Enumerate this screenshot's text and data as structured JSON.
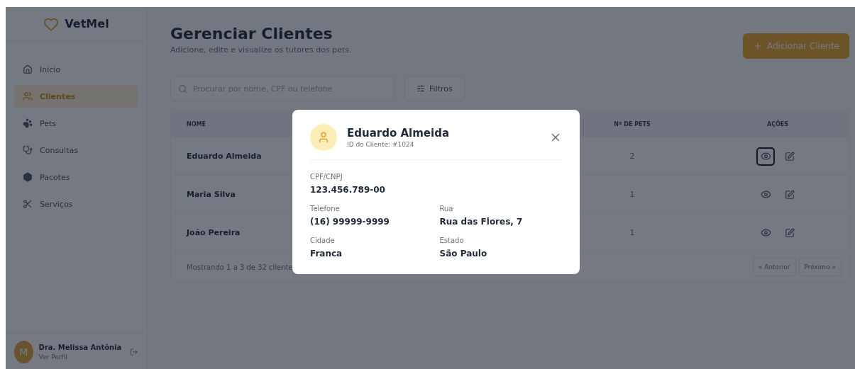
{
  "sidebar": {
    "brand": "VetMel",
    "items": [
      {
        "label": "Inicio",
        "selected": false
      },
      {
        "label": "Clientes",
        "selected": true
      },
      {
        "label": "Pets",
        "selected": false
      },
      {
        "label": "Consultas",
        "selected": false
      },
      {
        "label": "Pacotes",
        "selected": false
      },
      {
        "label": "Serviços",
        "selected": false
      }
    ],
    "user": {
      "initial": "M",
      "name": "Dra. Melissa Antônia",
      "link": "Ver Perfil"
    }
  },
  "header": {
    "title": "Gerenciar Clientes",
    "subtitle": "Adicione, edite e visualize os tutores dos pets.",
    "add_button": "Adicionar Cliente"
  },
  "search": {
    "placeholder": "Procurar por nome, CPF ou telefone"
  },
  "filter_button": "Filtros",
  "table": {
    "columns": [
      "NOME",
      "Nº DE PETS",
      "AÇÕES"
    ],
    "rows": [
      {
        "name": "Eduardo Almeida",
        "pets": "2",
        "view_focused": true
      },
      {
        "name": "Maria Silva",
        "pets": "1",
        "view_focused": false
      },
      {
        "name": "João Pereira",
        "pets": "1",
        "view_focused": false
      }
    ],
    "footer": "Mostrando 1 a 3 de 32 cliente",
    "pagination": [
      "« Anterior",
      "Próximo »"
    ]
  },
  "modal": {
    "name": "Eduardo Almeida",
    "client_id": "ID do Cliente: #1024",
    "fields": [
      {
        "label": "CPF/CNPJ",
        "value": "123.456.789-00"
      },
      {
        "label": "Telefone",
        "value": "(16) 99999-9999"
      },
      {
        "label": "Rua",
        "value": "Rua das Flores, 7"
      },
      {
        "label": "Cidade",
        "value": "Franca"
      },
      {
        "label": "Estado",
        "value": "São Paulo"
      }
    ]
  }
}
